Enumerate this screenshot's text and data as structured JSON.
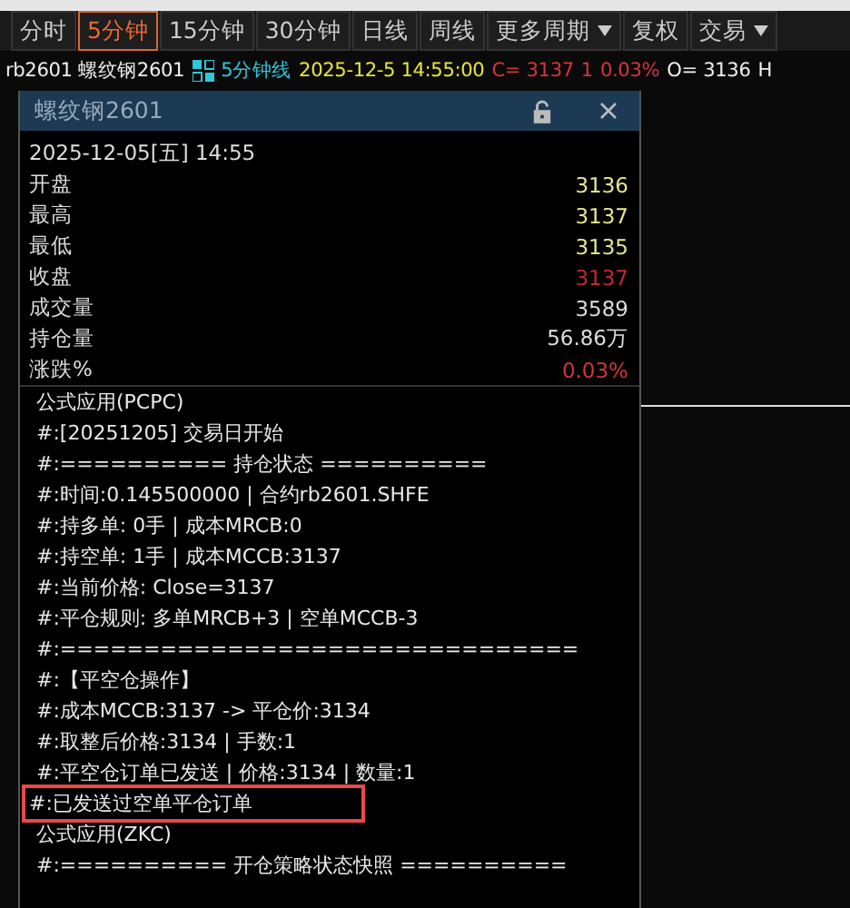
{
  "toolbar": {
    "tabs": [
      {
        "label": "分时",
        "selected": false,
        "dropdown": false
      },
      {
        "label": "5分钟",
        "selected": true,
        "dropdown": false
      },
      {
        "label": "15分钟",
        "selected": false,
        "dropdown": false
      },
      {
        "label": "30分钟",
        "selected": false,
        "dropdown": false
      },
      {
        "label": "日线",
        "selected": false,
        "dropdown": false
      },
      {
        "label": "周线",
        "selected": false,
        "dropdown": false
      },
      {
        "label": "更多周期",
        "selected": false,
        "dropdown": true
      },
      {
        "label": "复权",
        "selected": false,
        "dropdown": false
      },
      {
        "label": "交易",
        "selected": false,
        "dropdown": true
      }
    ]
  },
  "info_bar": {
    "symbol": "rb2601 螺纹钢2601",
    "period": "5分钟线",
    "datetime": "2025-12-5 14:55:00",
    "close": "C= 3137",
    "change": "1",
    "change_pct": "0.03%",
    "open": "O= 3136",
    "next": "H"
  },
  "panel": {
    "title": "螺纹钢2601",
    "date": "2025-12-05[五] 14:55",
    "quotes": [
      {
        "label": "开盘",
        "value": "3136",
        "color": "#e6e68c"
      },
      {
        "label": "最高",
        "value": "3137",
        "color": "#e6e68c"
      },
      {
        "label": "最低",
        "value": "3135",
        "color": "#e6e68c"
      },
      {
        "label": "收盘",
        "value": "3137",
        "color": "#c0282d"
      },
      {
        "label": "成交量",
        "value": "3589",
        "color": "#dddddd"
      },
      {
        "label": "持仓量",
        "value": "56.86万",
        "color": "#dddddd"
      },
      {
        "label": "涨跌%",
        "value": "0.03%",
        "color": "#d2343c"
      }
    ],
    "log": [
      {
        "text": "公式应用(PCPC)",
        "highlighted": false
      },
      {
        "text": "#:[20251205] 交易日开始",
        "highlighted": false
      },
      {
        "text": "#:========== 持仓状态 ==========",
        "highlighted": false
      },
      {
        "text": "#:时间:0.145500000 | 合约rb2601.SHFE",
        "highlighted": false
      },
      {
        "text": "#:持多单: 0手 | 成本MRCB:0",
        "highlighted": false
      },
      {
        "text": "#:持空单: 1手 | 成本MCCB:3137",
        "highlighted": false
      },
      {
        "text": "#:当前价格: Close=3137",
        "highlighted": false
      },
      {
        "text": "#:平仓规则: 多单MRCB+3 | 空单MCCB-3",
        "highlighted": false
      },
      {
        "text": "#:===============================",
        "highlighted": false
      },
      {
        "text": "#:【平空仓操作】",
        "highlighted": false
      },
      {
        "text": "#:成本MCCB:3137  -> 平仓价:3134",
        "highlighted": false
      },
      {
        "text": "#:取整后价格:3134 | 手数:1",
        "highlighted": false
      },
      {
        "text": "#:平空仓订单已发送 | 价格:3134 | 数量:1",
        "highlighted": false
      },
      {
        "text": "#:已发送过空单平仓订单",
        "highlighted": true
      },
      {
        "text": "公式应用(ZKC)",
        "highlighted": false
      },
      {
        "text": "#:========== 开仓策略状态快照 ==========",
        "highlighted": false
      }
    ]
  }
}
